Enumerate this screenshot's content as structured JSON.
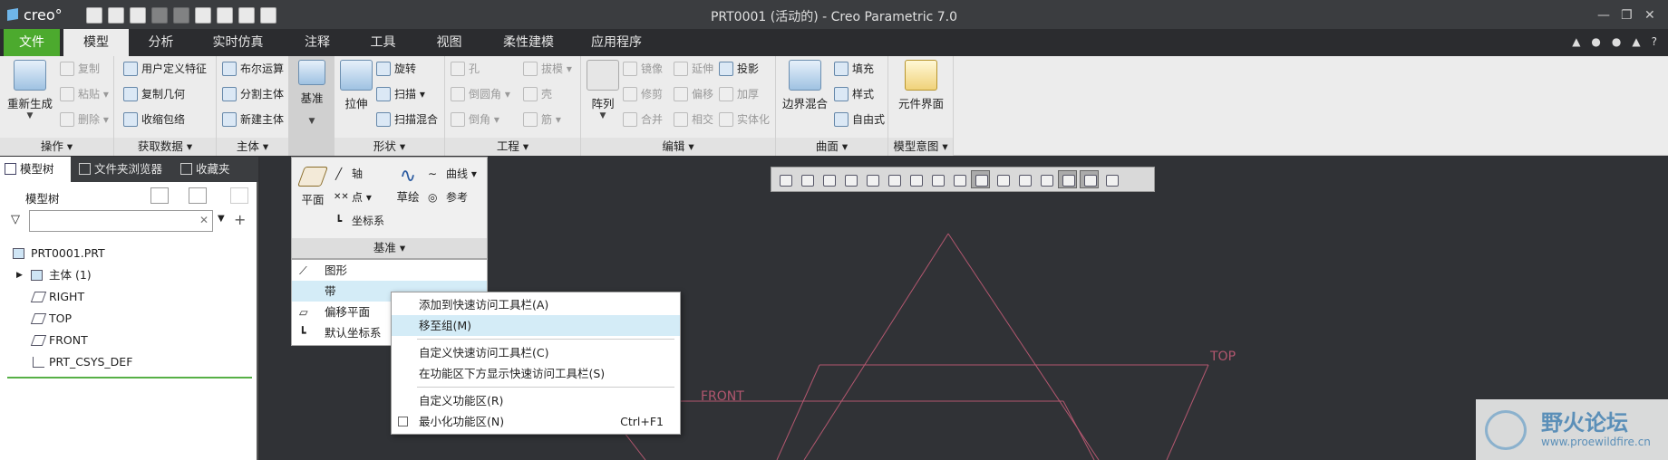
{
  "window": {
    "title": "PRT0001 (活动的) - Creo Parametric 7.0",
    "app_logo": "creo°"
  },
  "tabs": [
    "文件",
    "模型",
    "分析",
    "实时仿真",
    "注释",
    "工具",
    "视图",
    "柔性建模",
    "应用程序"
  ],
  "ribbon": {
    "ops": {
      "label": "操作",
      "regen": "重新生成",
      "copy": "复制",
      "paste": "粘贴",
      "delete": "删除"
    },
    "get": {
      "label": "获取数据",
      "udf": "用户定义特征",
      "copy_geom": "复制几何",
      "shrinkwrap": "收缩包络"
    },
    "body": {
      "label": "主体",
      "boolean": "布尔运算",
      "split": "分割主体",
      "new": "新建主体"
    },
    "datum": {
      "label": "基准"
    },
    "shape": {
      "label": "形状",
      "extrude": "拉伸",
      "revolve": "旋转",
      "sweep": "扫描",
      "sweep_blend": "扫描混合"
    },
    "eng": {
      "label": "工程",
      "hole": "孔",
      "round": "倒圆角",
      "chamfer": "倒角",
      "draft": "拔模",
      "shell": "壳",
      "rib": "筋"
    },
    "edit": {
      "label": "编辑",
      "pattern": "阵列",
      "mirror": "镜像",
      "extend": "延伸",
      "project": "投影",
      "trim": "修剪",
      "offset": "偏移",
      "thicken": "加厚",
      "merge": "合并",
      "intersect": "相交",
      "solidify": "实体化"
    },
    "surface": {
      "label": "曲面",
      "boundary": "边界混合",
      "fill": "填充",
      "style": "样式",
      "freeform": "自由式"
    },
    "intent": {
      "label": "模型意图",
      "component_interface": "元件界面"
    }
  },
  "left_panel": {
    "tabs": [
      "模型树",
      "文件夹浏览器",
      "收藏夹"
    ],
    "header": "模型树",
    "tree": [
      "PRT0001.PRT",
      "主体 (1)",
      "RIGHT",
      "TOP",
      "FRONT",
      "PRT_CSYS_DEF"
    ]
  },
  "datum_menu": {
    "plane": "平面",
    "axis": "轴",
    "point": "点",
    "csys": "坐标系",
    "sketch": "草绘",
    "curve": "曲线",
    "ref": "参考",
    "footer": "基准"
  },
  "datum_list": [
    "图形",
    "带",
    "偏移平面",
    "默认坐标系"
  ],
  "context_menu": {
    "add_qat": "添加到快速访问工具栏(A)",
    "move_group": "移至组(M)",
    "customize_qat": "自定义快速访问工具栏(C)",
    "show_below": "在功能区下方显示快速访问工具栏(S)",
    "customize_ribbon": "自定义功能区(R)",
    "minimize_ribbon": "最小化功能区(N)",
    "minimize_shortcut": "Ctrl+F1"
  },
  "viewport": {
    "label_top": "TOP",
    "label_front": "FRONT"
  },
  "watermark": {
    "title": "野火论坛",
    "url": "www.proewildfire.cn"
  }
}
